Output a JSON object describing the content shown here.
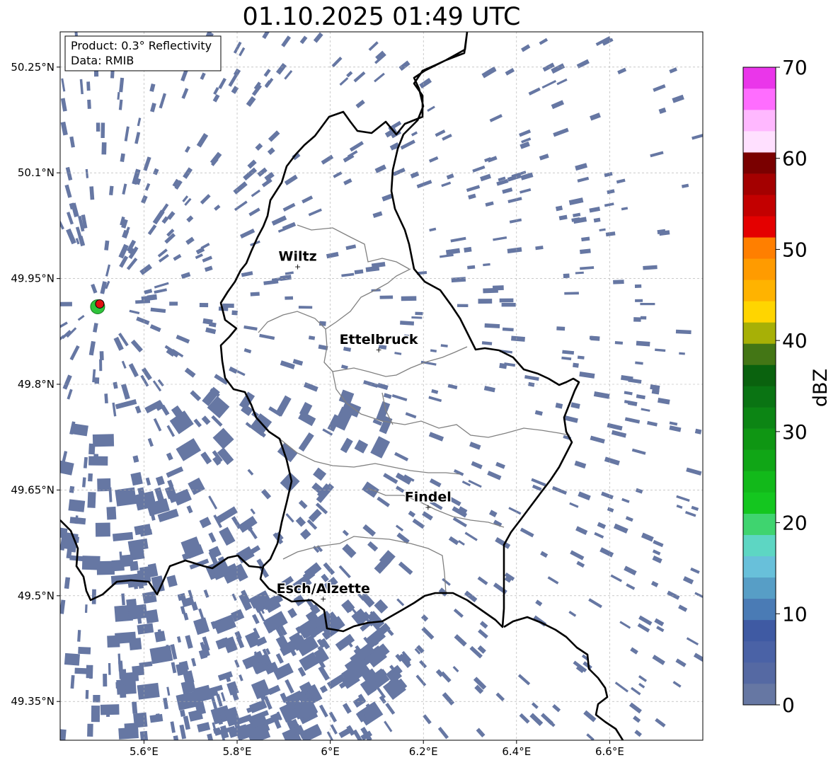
{
  "title": "01.10.2025 01:49 UTC",
  "info_box": {
    "product": "Product: 0.3° Reflectivity",
    "data": "Data: RMIB"
  },
  "map": {
    "lon_range": [
      5.42,
      6.8
    ],
    "lat_range": [
      49.295,
      50.3
    ],
    "x_ticks": [
      {
        "value": 5.6,
        "label": "5.6°E"
      },
      {
        "value": 5.8,
        "label": "5.8°E"
      },
      {
        "value": 6.0,
        "label": "6°E"
      },
      {
        "value": 6.2,
        "label": "6.2°E"
      },
      {
        "value": 6.4,
        "label": "6.4°E"
      },
      {
        "value": 6.6,
        "label": "6.6°E"
      }
    ],
    "y_ticks": [
      {
        "value": 50.25,
        "label": "50.25°N"
      },
      {
        "value": 50.1,
        "label": "50.1°N"
      },
      {
        "value": 49.95,
        "label": "49.95°N"
      },
      {
        "value": 49.8,
        "label": "49.8°N"
      },
      {
        "value": 49.65,
        "label": "49.65°N"
      },
      {
        "value": 49.5,
        "label": "49.5°N"
      },
      {
        "value": 49.35,
        "label": "49.35°N"
      }
    ],
    "cities": [
      {
        "name": "Wiltz",
        "lon": 5.93,
        "lat": 49.967
      },
      {
        "name": "Ettelbruck",
        "lon": 6.104,
        "lat": 49.849
      },
      {
        "name": "Findel",
        "lon": 6.21,
        "lat": 49.626
      },
      {
        "name": "Esch/Alzette",
        "lon": 5.985,
        "lat": 49.496
      }
    ],
    "radar_site": {
      "lon": 5.505,
      "lat": 49.914
    },
    "precip_color": "#6677a3",
    "border_color": "#000000",
    "canton_color": "#808080"
  },
  "colorbar": {
    "label": "dBZ",
    "min": 0,
    "max": 70,
    "step": 2.5,
    "ticks": [
      {
        "value": 0,
        "label": "0"
      },
      {
        "value": 10,
        "label": "10"
      },
      {
        "value": 20,
        "label": "20"
      },
      {
        "value": 30,
        "label": "30"
      },
      {
        "value": 40,
        "label": "40"
      },
      {
        "value": 50,
        "label": "50"
      },
      {
        "value": 60,
        "label": "60"
      },
      {
        "value": 70,
        "label": "70"
      }
    ],
    "colors": [
      "#6677a3",
      "#5569a3",
      "#4a62a6",
      "#3f5aa3",
      "#4a7bb5",
      "#579ec6",
      "#68c0da",
      "#5dd6c3",
      "#3fd46f",
      "#14c61f",
      "#12b91a",
      "#10a616",
      "#0f9613",
      "#0c8514",
      "#0a7413",
      "#0a620e",
      "#437615",
      "#a7b006",
      "#ffd500",
      "#ffb300",
      "#ff9b00",
      "#ff7f00",
      "#e40000",
      "#c30000",
      "#a40000",
      "#7a0000",
      "#ffe0ff",
      "#ffb8ff",
      "#ff6dff",
      "#ea36ea"
    ]
  }
}
